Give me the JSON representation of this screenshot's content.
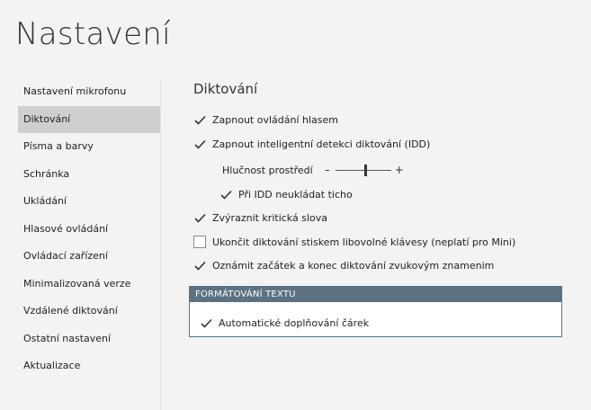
{
  "window": {
    "title": "Nastavení"
  },
  "sidebar": {
    "items": [
      {
        "label": "Nastavení mikrofonu"
      },
      {
        "label": "Diktování"
      },
      {
        "label": "Písma a barvy"
      },
      {
        "label": "Schránka"
      },
      {
        "label": "Ukládání"
      },
      {
        "label": "Hlasové ovládání"
      },
      {
        "label": "Ovládací zařízení"
      },
      {
        "label": "Minimalizovaná verze"
      },
      {
        "label": "Vzdálené diktování"
      },
      {
        "label": "Ostatní nastavení"
      },
      {
        "label": "Aktualizace"
      }
    ],
    "selected": "Diktování"
  },
  "main": {
    "section_title": "Diktování",
    "options": [
      {
        "label": "Zapnout ovládání hlasem",
        "checked": true
      },
      {
        "label": "Zapnout inteligentní detekci diktování (IDD)",
        "checked": true
      },
      {
        "label": "Při IDD neukládat ticho",
        "checked": true
      },
      {
        "label": "Zvýraznit kritická slova",
        "checked": true
      },
      {
        "label": "Ukončit diktování stiskem libovolné klávesy (neplatí pro Mini)",
        "checked": false
      },
      {
        "label": "Oznámit začátek a konec diktování zvukovým znamenim",
        "checked": true
      }
    ],
    "noise": {
      "label": "Hlučnost prostředí",
      "minus": "–",
      "plus": "+",
      "level": 0.55
    },
    "text_format": {
      "header": "FORMÁTOVÁNÍ TEXTU",
      "option": {
        "label": "Automatické doplňování čárek",
        "checked": true
      }
    }
  },
  "colors": {
    "check": "#333333",
    "group_header": "#5c7182",
    "selected_item": "#cfcfcf"
  }
}
